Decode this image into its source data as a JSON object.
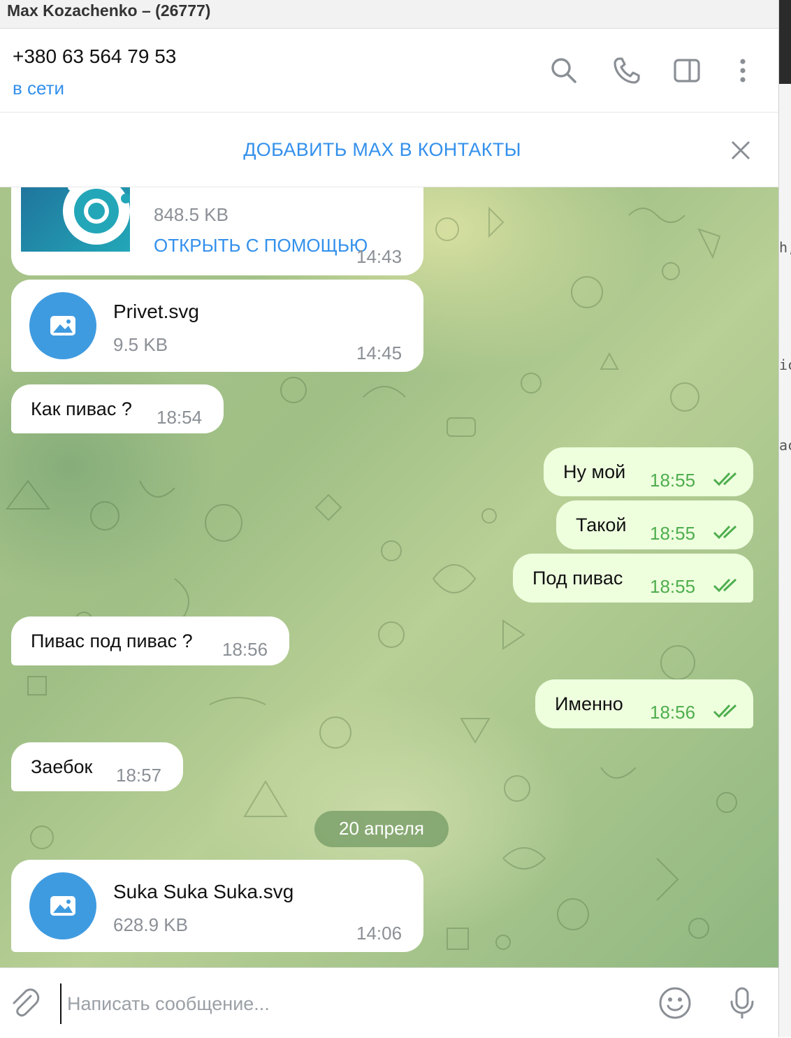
{
  "window": {
    "title": "Max Kozachenko – (26777)"
  },
  "header": {
    "contact_name": "+380 63 564 79 53",
    "status": "в сети",
    "icons": [
      "search-icon",
      "phone-icon",
      "sidebar-toggle-icon",
      "more-vertical-icon"
    ]
  },
  "banner": {
    "add_contact_label": "ДОБАВИТЬ MAX В КОНТАКТЫ",
    "close_icon": "close-icon"
  },
  "messages": {
    "file1": {
      "size": "848.5 KB",
      "open_label": "ОТКРЫТЬ С ПОМОЩЬЮ",
      "time": "14:43"
    },
    "file2": {
      "name": "Privet.svg",
      "size": "9.5 KB",
      "time": "14:45"
    },
    "m1": {
      "text": "Как пивас ?",
      "time": "18:54"
    },
    "m2": {
      "text": "Ну мой",
      "time": "18:55"
    },
    "m3": {
      "text": "Такой",
      "time": "18:55"
    },
    "m4": {
      "text": "Под пивас",
      "time": "18:55"
    },
    "m5": {
      "text": "Пивас под пивас ?",
      "time": "18:56"
    },
    "m6": {
      "text": "Именно",
      "time": "18:56"
    },
    "m7": {
      "text": "Заебок",
      "time": "18:57"
    },
    "date_separator": "20 апреля",
    "file3": {
      "name": "Suka Suka Suka.svg",
      "size": "628.9 KB",
      "time": "14:06"
    }
  },
  "composer": {
    "placeholder": "Написать сообщение...",
    "icons": [
      "paperclip-icon",
      "emoji-icon",
      "microphone-icon"
    ]
  },
  "background_window_fragments": [
    "h,",
    "ic",
    "ac"
  ],
  "colors": {
    "accent": "#3390ec",
    "outgoing_bubble": "#eeffde",
    "read_check": "#4fae4e",
    "file_icon_bg": "#3f9be0"
  }
}
